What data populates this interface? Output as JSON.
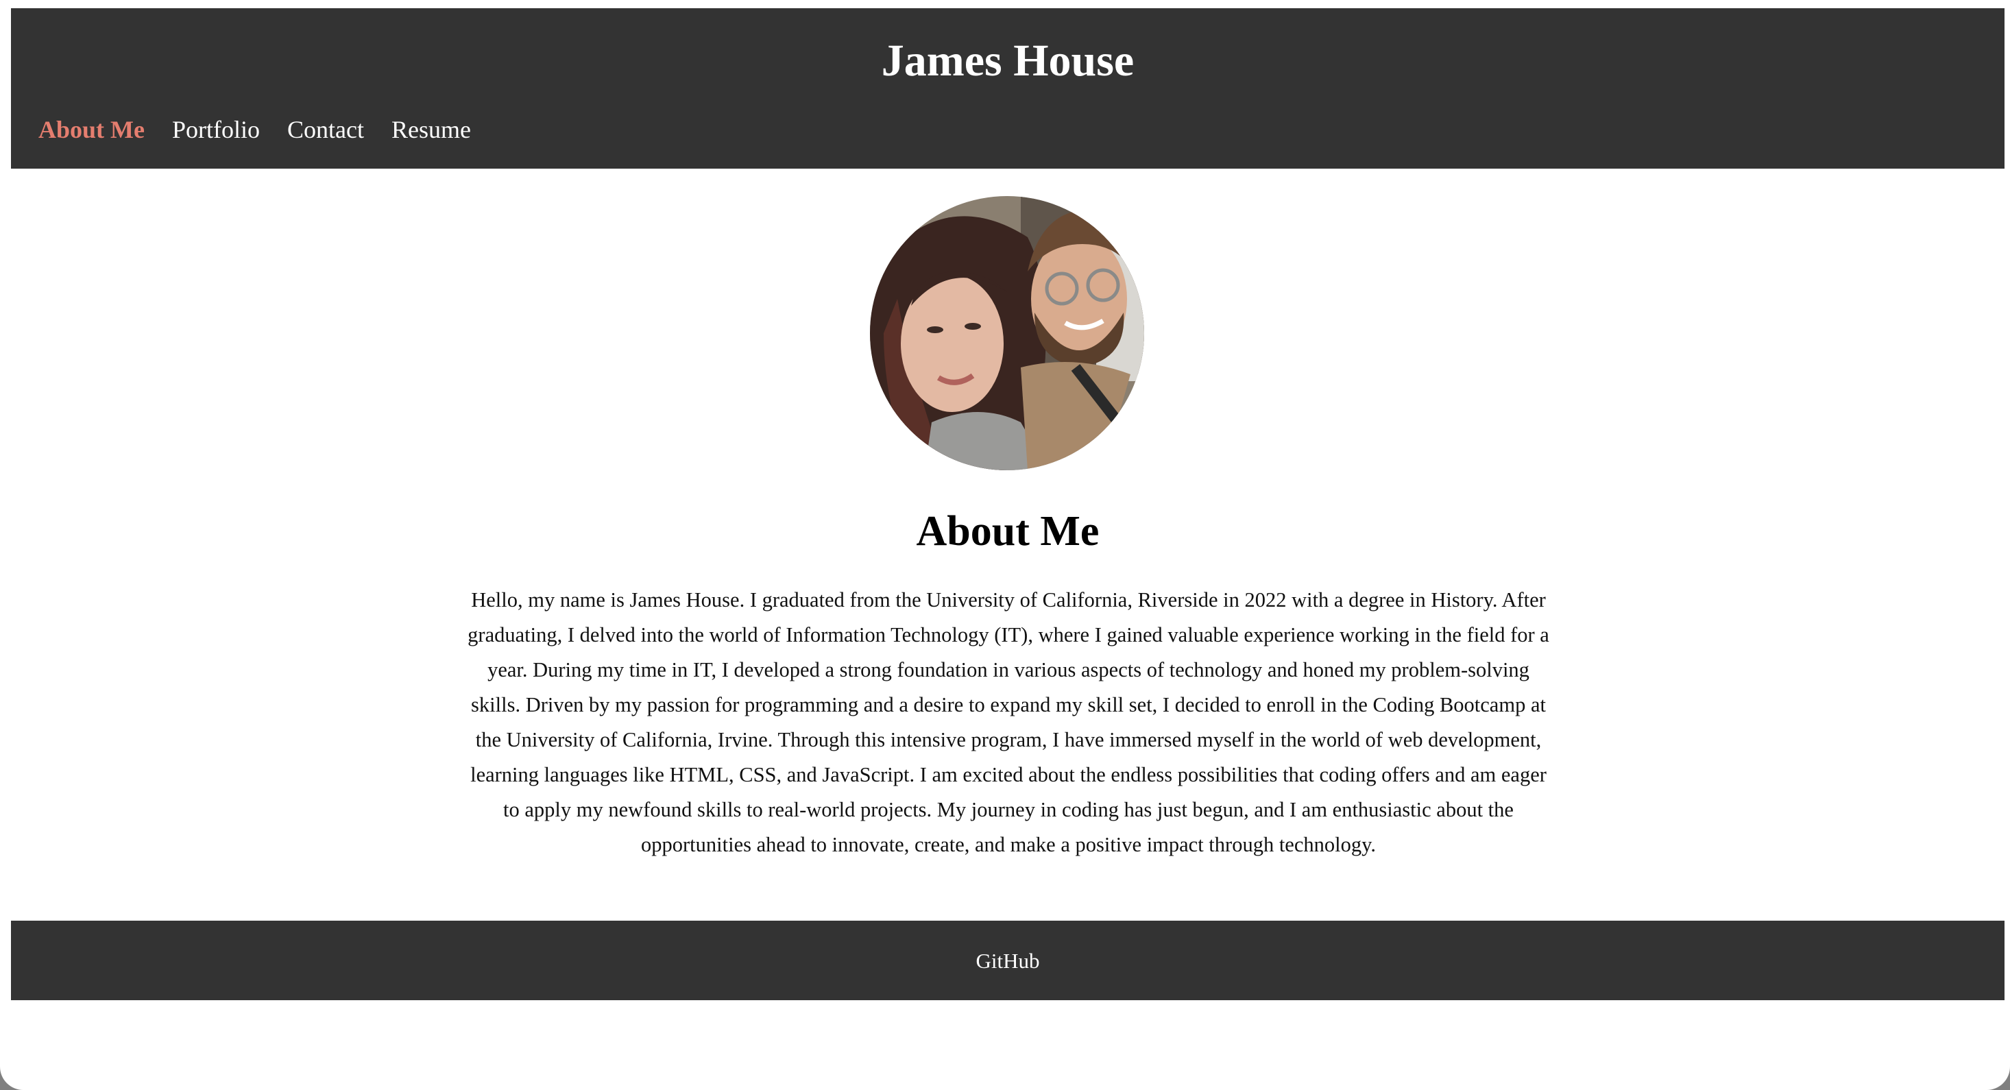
{
  "header": {
    "title": "James House",
    "nav": [
      {
        "label": "About Me",
        "active": true
      },
      {
        "label": "Portfolio",
        "active": false
      },
      {
        "label": "Contact",
        "active": false
      },
      {
        "label": "Resume",
        "active": false
      }
    ]
  },
  "about": {
    "heading": "About Me",
    "bio": "Hello, my name is James House. I graduated from the University of California, Riverside in 2022 with a degree in History. After graduating, I delved into the world of Information Technology (IT), where I gained valuable experience working in the field for a year. During my time in IT, I developed a strong foundation in various aspects of technology and honed my problem-solving skills. Driven by my passion for programming and a desire to expand my skill set, I decided to enroll in the Coding Bootcamp at the University of California, Irvine. Through this intensive program, I have immersed myself in the world of web development, learning languages like HTML, CSS, and JavaScript. I am excited about the endless possibilities that coding offers and am eager to apply my newfound skills to real-world projects. My journey in coding has just begun, and I am enthusiastic about the opportunities ahead to innovate, create, and make a positive impact through technology."
  },
  "footer": {
    "link_label": "GitHub"
  },
  "colors": {
    "header_bg": "#333333",
    "active_nav": "#e57e6f",
    "text_light": "#ffffff",
    "text_dark": "#000000"
  }
}
